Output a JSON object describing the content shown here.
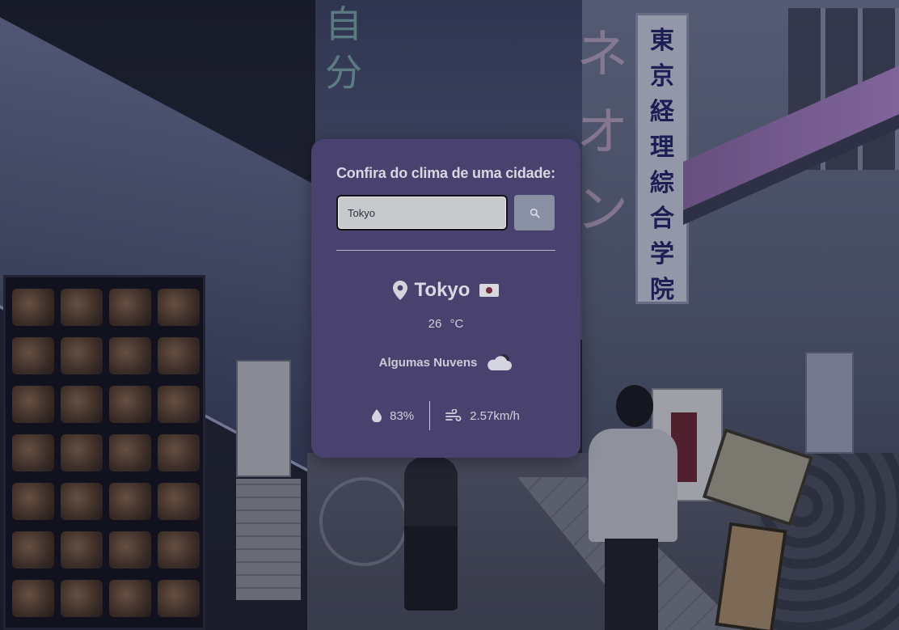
{
  "card": {
    "title": "Confira do clima de uma cidade:",
    "search": {
      "value": "Tokyo",
      "button_icon": "search-icon"
    },
    "city": {
      "name": "Tokyo",
      "pin_icon": "map-pin-icon",
      "flag_icon": "japan-flag-icon"
    },
    "temperature": {
      "value": "26",
      "unit": "°C"
    },
    "description": {
      "text": "Algumas Nuvens",
      "icon": "cloud-icon"
    },
    "details": {
      "humidity": {
        "value": "83%",
        "icon": "water-drop-icon"
      },
      "wind": {
        "value": "2.57km/h",
        "icon": "wind-icon"
      }
    }
  },
  "colors": {
    "card_bg": "#4a426e",
    "input_bg": "#c7c9cd",
    "button_bg": "#8a90a4",
    "text": "#cfd0dc"
  },
  "background": {
    "sign_vertical_text": [
      "東",
      "京",
      "経",
      "理",
      "綜",
      "合",
      "学",
      "院"
    ],
    "neon_right_text": [
      "ネ",
      "オ",
      "ン"
    ],
    "neon_left_text": [
      "自",
      "分"
    ]
  }
}
